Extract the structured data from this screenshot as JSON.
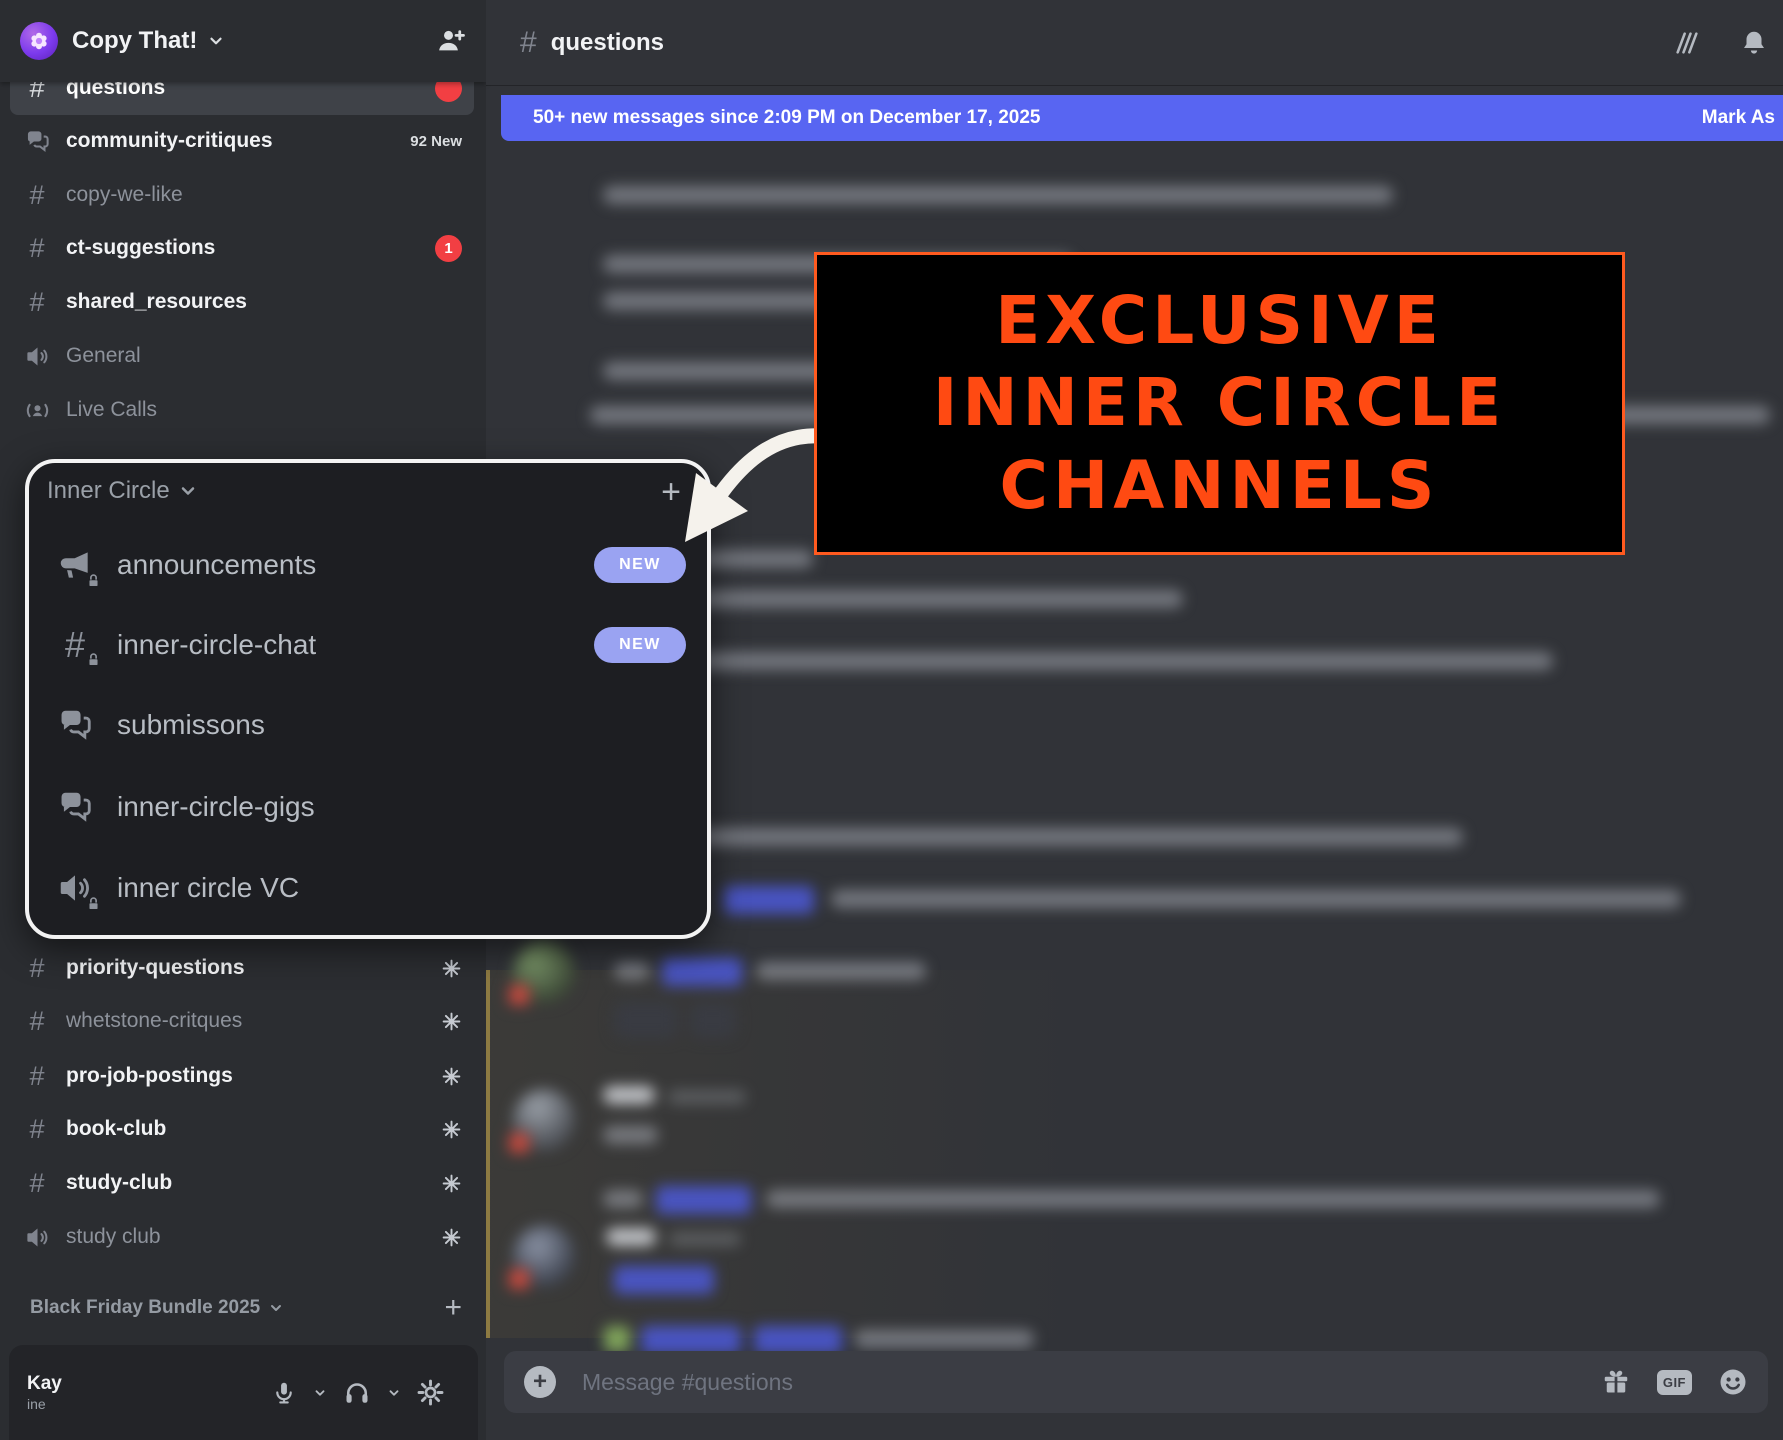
{
  "icons": {
    "hash": "#",
    "plus": "+"
  },
  "server_header": {
    "name": "Copy That!"
  },
  "sidebar": {
    "channels_top": [
      {
        "label": "questions",
        "badge": ""
      },
      {
        "label": "community-critiques",
        "meta": "92 New"
      },
      {
        "label": "copy-we-like"
      },
      {
        "label": "ct-suggestions",
        "badge": "1"
      },
      {
        "label": "shared_resources"
      },
      {
        "label": "General"
      },
      {
        "label": "Live Calls"
      }
    ],
    "inner_circle": {
      "title": "Inner Circle",
      "items": [
        {
          "label": "announcements",
          "badge": "NEW"
        },
        {
          "label": "inner-circle-chat",
          "badge": "NEW"
        },
        {
          "label": "submissons"
        },
        {
          "label": "inner-circle-gigs"
        },
        {
          "label": "inner circle VC"
        }
      ]
    },
    "channels_bottom": [
      {
        "label": "priority-questions"
      },
      {
        "label": "whetstone-critques"
      },
      {
        "label": "pro-job-postings"
      },
      {
        "label": "book-club"
      },
      {
        "label": "study-club"
      },
      {
        "label": "study club"
      }
    ],
    "category_bottom": {
      "title": "Black Friday Bundle 2025"
    },
    "user_panel": {
      "name": "Kay",
      "status": "ine"
    }
  },
  "chat_header": {
    "channel": "questions"
  },
  "unread_banner": {
    "text": "50+ new messages since 2:09 PM on December 17, 2025",
    "action": "Mark As"
  },
  "composer": {
    "placeholder": "Message #questions",
    "gif": "GIF"
  },
  "annotation": {
    "line1": "EXCLUSIVE",
    "line2": "INNER CIRCLE",
    "line3": "CHANNELS"
  }
}
